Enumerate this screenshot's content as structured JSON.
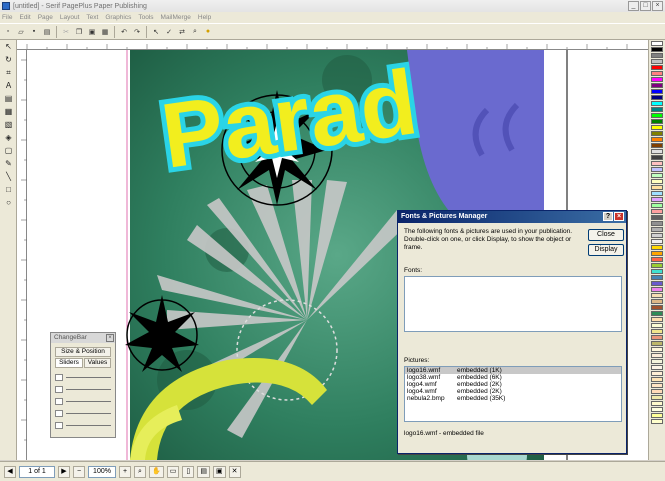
{
  "window": {
    "title": "[untitled] - Serif PagePlus Paper Publishing",
    "min": "_",
    "max": "□",
    "close": "×"
  },
  "menu": [
    "File",
    "Edit",
    "Page",
    "Layout",
    "Text",
    "Graphics",
    "Tools",
    "MailMerge",
    "Help"
  ],
  "toolbar_icons": [
    "new-icon",
    "open-icon",
    "save-icon",
    "print-icon",
    "cut-icon",
    "copy-icon",
    "paste-icon",
    "format-painter-icon",
    "undo-icon",
    "redo-icon",
    "pointer-icon",
    "spell-icon",
    "replace-icon",
    "find-icon",
    "tip-icon"
  ],
  "artwork": {
    "text": "Parad",
    "colors": {
      "background": "#3a8a6a",
      "headline": "#f2ee1e",
      "headline_outline": "#2ad4e6",
      "swirl": "#6a6acf",
      "yellow_arc": "#d6e23a"
    }
  },
  "fonts_pictures_dialog": {
    "title": "Fonts & Pictures Manager",
    "help": "?",
    "close_x": "×",
    "description": "The following fonts & pictures are used in your publication. Double-click on one, or click Display, to show the object or frame.",
    "close_button": "Close",
    "display_button": "Display",
    "fonts_label": "Fonts:",
    "fonts": [],
    "pictures_label": "Pictures:",
    "pictures": [
      {
        "name": "logo16.wmf",
        "status": "embedded (1K)",
        "selected": true
      },
      {
        "name": "logo38.wmf",
        "status": "embedded (6K)",
        "selected": false
      },
      {
        "name": "logo4.wmf",
        "status": "embedded (2K)",
        "selected": false
      },
      {
        "name": "logo4.wmf",
        "status": "embedded (2K)",
        "selected": false
      },
      {
        "name": "nebula2.bmp",
        "status": "embedded (35K)",
        "selected": false
      }
    ],
    "status_line": "logo16.wmf - embedded file"
  },
  "changebar": {
    "title": "ChangeBar",
    "close_x": "×",
    "tab_top": "Size & Position",
    "tab_left": "Sliders",
    "tab_right": "Values"
  },
  "statusbar": {
    "page": "1 of 1",
    "zoom": "100%"
  },
  "swatches": [
    "#ffffff",
    "#000000",
    "#808080",
    "#c0c0c0",
    "#ff0000",
    "#ff8080",
    "#ff00ff",
    "#800080",
    "#0000ff",
    "#000080",
    "#00ffff",
    "#008080",
    "#00ff00",
    "#008000",
    "#ffff00",
    "#808000",
    "#ff8000",
    "#804000",
    "#e0e0e0",
    "#404040",
    "#ffc0c0",
    "#c0c0ff",
    "#c0ffc0",
    "#ffffc0",
    "#ffe0a0",
    "#a0e0ff",
    "#e0a0ff",
    "#a0ffa0",
    "#ffa0a0",
    "#606060",
    "#909090",
    "#b0b0b0",
    "#d0d0d0",
    "#f0f0f0",
    "#ffd700",
    "#ffa500",
    "#ff6347",
    "#9acd32",
    "#40e0d0",
    "#4682b4",
    "#6a5acd",
    "#ee82ee",
    "#f5deb3",
    "#deb887",
    "#a0522d",
    "#2e8b57",
    "#ffdead",
    "#fafad2",
    "#f0e68c",
    "#e9967a",
    "#bdb76b",
    "#fff8dc",
    "#faebd7",
    "#f5f5dc",
    "#fdf5e6",
    "#ffefd5",
    "#ffe4b5",
    "#ffe4c4",
    "#ffdab9",
    "#eee8aa",
    "#fffacd",
    "#ffffe0",
    "#ffff99",
    "#ffffcc"
  ]
}
